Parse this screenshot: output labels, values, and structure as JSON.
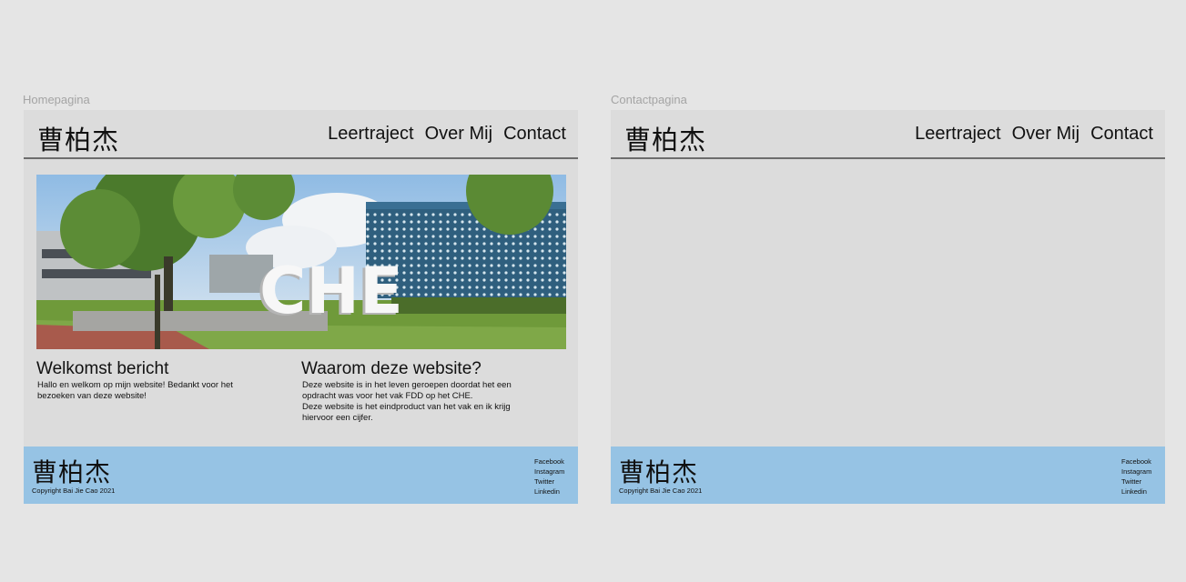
{
  "frames": {
    "home_label": "Homepagina",
    "contact_label": "Contactpagina"
  },
  "site": {
    "logo": "曹柏杰",
    "nav": [
      "Leertraject",
      "Over Mij",
      "Contact"
    ]
  },
  "home": {
    "hero_sign_text": "CHE",
    "welcome_title": "Welkomst bericht",
    "welcome_text": "Hallo en welkom op mijn website! Bedankt voor het bezoeken van deze website!",
    "why_title": "Waarom deze website?",
    "why_text_1": "Deze website is in het leven geroepen doordat het een opdracht was voor het vak FDD op het CHE.",
    "why_text_2": "Deze website is het eindproduct van het vak en ik krijg hiervoor een cijfer."
  },
  "footer": {
    "logo": "曹柏杰",
    "copyright": "Copyright Bai Jie Cao 2021",
    "links": [
      "Facebook",
      "Instagram",
      "Twitter",
      "Linkedin"
    ]
  },
  "colors": {
    "page_bg": "#e5e5e5",
    "frame_bg": "#dcdcdc",
    "footer_bg": "#96c3e4",
    "header_rule": "#6d6d6d"
  }
}
